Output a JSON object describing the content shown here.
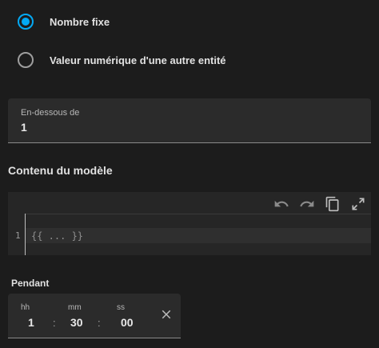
{
  "radio_group": {
    "options": [
      {
        "label": "Nombre fixe",
        "checked": true
      },
      {
        "label": "Valeur numérique d'une autre entité",
        "checked": false
      }
    ],
    "accent_color": "#03a9f4"
  },
  "below_field": {
    "label": "En-dessous de",
    "value": "1"
  },
  "template_section": {
    "title": "Contenu du modèle",
    "toolbar": {
      "undo_icon": "undo-icon",
      "redo_icon": "redo-icon",
      "copy_icon": "copy-icon",
      "fullscreen_icon": "fullscreen-icon"
    },
    "editor": {
      "line_number": "1",
      "code": "{{ ... }}"
    }
  },
  "duration": {
    "title": "Pendant",
    "hours_label": "hh",
    "hours_value": "1",
    "minutes_label": "mm",
    "minutes_value": "30",
    "seconds_label": "ss",
    "seconds_value": "00",
    "separator": ":",
    "clear_icon": "close-icon"
  }
}
